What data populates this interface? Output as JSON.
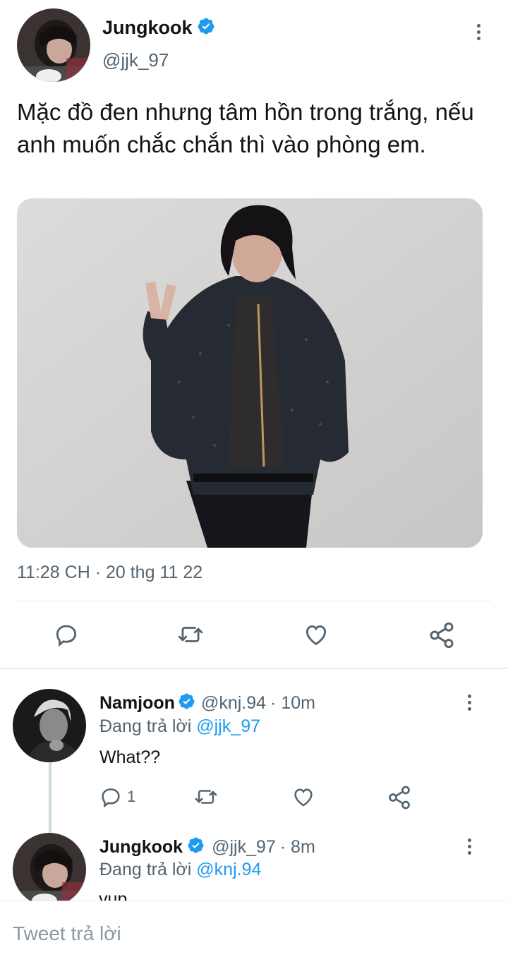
{
  "tweet": {
    "author": {
      "name": "Jungkook",
      "handle": "@jjk_97",
      "verified": true
    },
    "text": "Mặc đồ đen nhưng tâm hồn trong trắng, nếu anh muốn chắc chắn thì vào phòng em.",
    "timestamp": "11:28 CH · 20 thg 11 22",
    "photo_icon": "person-photo",
    "actions": [
      "reply-icon",
      "retweet-icon",
      "like-icon",
      "share-icon"
    ]
  },
  "replies": [
    {
      "name": "Namjoon",
      "handle": "@knj.94",
      "time": "· 10m",
      "replying_prefix": "Đang trả lời",
      "replying_to": "@jjk_97",
      "text": "What??",
      "reply_count": "1",
      "verified": true
    },
    {
      "name": "Jungkook",
      "handle": "@jjk_97",
      "time": "· 8m",
      "replying_prefix": "Đang trả lời",
      "replying_to": "@knj.94",
      "text": "yup",
      "verified": true
    }
  ],
  "composer": {
    "placeholder": "Tweet trả lời"
  },
  "colors": {
    "accent": "#1d9bf0",
    "text": "#0f1419",
    "muted": "#536471",
    "divider": "#e7e9ea"
  }
}
